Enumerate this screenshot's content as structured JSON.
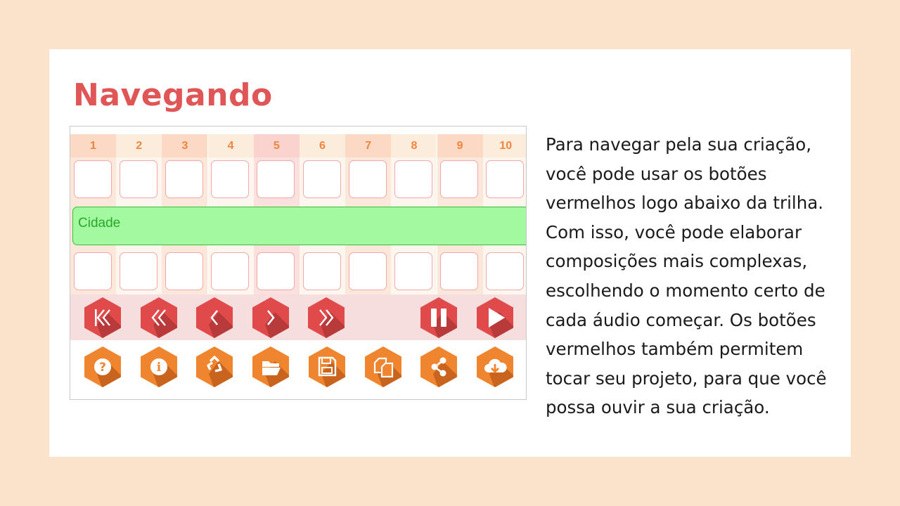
{
  "slide": {
    "title": "Navegando",
    "paragraph": "Para navegar pela sua criação, você pode usar os botões vermelhos logo abaixo da trilha. Com isso, você pode elaborar composições mais complexas, escolhendo o momento certo de cada áudio começar. Os botões vermelhos também permitem tocar seu projeto, para que você possa ouvir a sua criação."
  },
  "composer": {
    "columns": [
      "1",
      "2",
      "3",
      "4",
      "5",
      "6",
      "7",
      "8",
      "9",
      "10"
    ],
    "highlighted_column": "5",
    "audio_block_label": "Cidade",
    "nav_buttons": [
      "skip-to-start-icon",
      "rewind-icon",
      "previous-icon",
      "next-icon",
      "fast-forward-icon",
      "pause-icon",
      "play-icon"
    ],
    "tool_buttons": [
      "help-icon",
      "info-icon",
      "recycle-icon",
      "open-folder-icon",
      "save-icon",
      "copy-icon",
      "share-icon",
      "cloud-download-icon"
    ]
  },
  "colors": {
    "background": "#fae3ca",
    "title": "#e05555",
    "nav_button": "#e04a4a",
    "tool_button": "#f0852f",
    "audio_block": "#a3f99f",
    "column_number": "#f0853d"
  }
}
